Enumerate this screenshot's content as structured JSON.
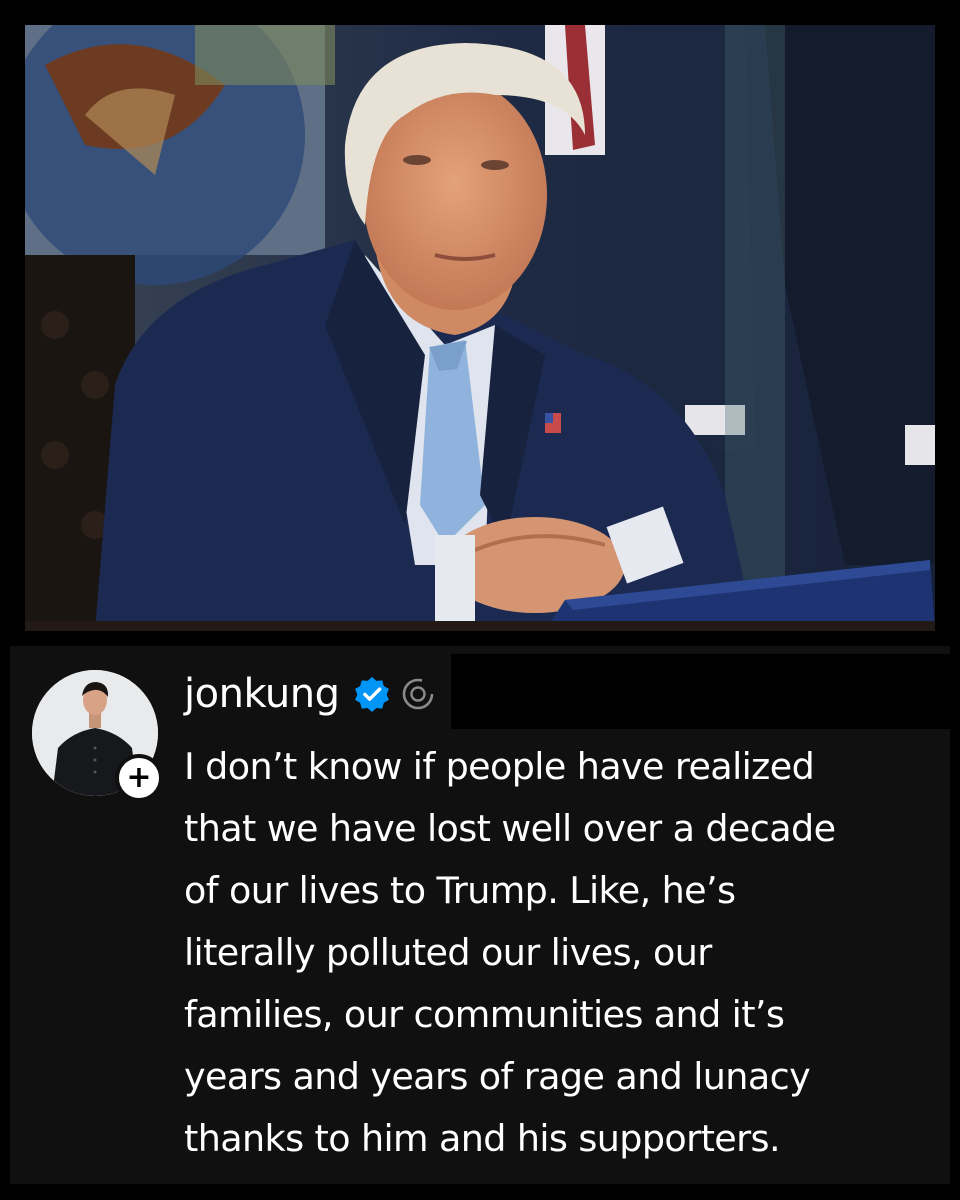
{
  "post": {
    "username": "jonkung",
    "verified_icon": "verified-badge-icon",
    "threads_icon": "threads-logo-icon",
    "follow_icon": "plus-icon",
    "text_lines": [
      "I don’t know if people have realized",
      "that we have lost well over a decade",
      "of our lives to Trump. Like, he’s",
      "literally polluted our lives, our",
      "families, our communities and it’s",
      "years and years of rage and lunacy",
      "thanks to him and his supporters."
    ]
  },
  "colors": {
    "background": "#000000",
    "card": "#101010",
    "text": "#ffffff",
    "verified": "#0095f6"
  }
}
